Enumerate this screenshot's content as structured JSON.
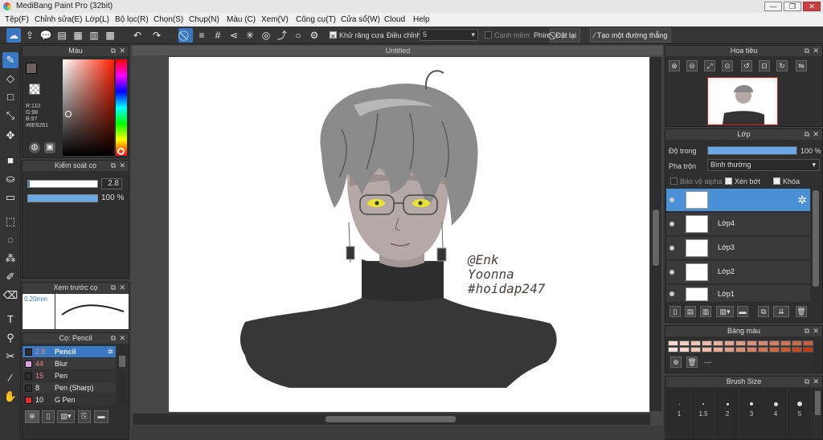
{
  "window": {
    "title": "MediBang Paint Pro (32bit)",
    "min": "—",
    "max": "❐",
    "close": "✕"
  },
  "menu": [
    "Tệp(F)",
    "Chỉnh sửa(E)",
    "Lớp(L)",
    "Bộ lọc(R)",
    "Chọn(S)",
    "Chụp(N)",
    "Màu (C)",
    "Xem(V)",
    "Công cụ(T)",
    "Cửa sổ(W)",
    "Cloud",
    "Help"
  ],
  "toolbar": {
    "antialias_label": "Khử răng cưa",
    "adjust_label": "Điều chỉnh",
    "adjust_value": "5",
    "edge_label": "Cạnh mềm",
    "key_label": "Phím",
    "reset_label": "Đặt lại",
    "new_line_label": "Tạo một đường thẳng"
  },
  "color_panel": {
    "title": "Màu",
    "r": "R:110",
    "g": "G:98",
    "b": "B:97",
    "hex": "#6E6261",
    "primary_color": "#6E6261",
    "hue_color": "#ff2200"
  },
  "brush_control": {
    "title": "Kiểm soát cọ",
    "size_value": "2.8",
    "opacity_value": "100 %"
  },
  "brush_preview": {
    "title": "Xem trước cọ",
    "size_text": "0.20mm"
  },
  "brush_panel": {
    "title": "Cọ: Pencil",
    "items": [
      {
        "size": "2.8",
        "name": "Pencil",
        "color": "#2d2d2d"
      },
      {
        "size": "44",
        "name": "Blur",
        "color": "#e79ee0"
      },
      {
        "size": "15",
        "name": "Pen",
        "color": "#2d2d2d"
      },
      {
        "size": "8",
        "name": "Pen (Sharp)",
        "color": "#2d2d2d"
      },
      {
        "size": "10",
        "name": "G Pen",
        "color": "#e03030"
      }
    ]
  },
  "canvas": {
    "tab_title": "Untitled",
    "signature_line1": "@Enk",
    "signature_line2": "Yoonna",
    "signature_line3": "#hoidap247"
  },
  "navigator": {
    "title": "Hoa tiêu"
  },
  "layers": {
    "title": "Lớp",
    "opacity_label": "Độ trong",
    "opacity_value": "100 %",
    "opacity_fraction": 1.0,
    "blend_label": "Pha trộn",
    "blend_value": "Bình thường",
    "protect_alpha": "Bảo vệ alpha",
    "clipping": "Xén bớt",
    "lock": "Khóa",
    "items": [
      {
        "name": "",
        "selected": true
      },
      {
        "name": "Lớp4",
        "selected": false
      },
      {
        "name": "Lớp3",
        "selected": false
      },
      {
        "name": "Lớp2",
        "selected": false
      },
      {
        "name": "Lớp1",
        "selected": false
      }
    ]
  },
  "palette": {
    "title": "Bảng màu",
    "extra_label": "---",
    "colors": [
      "#f7d9cf",
      "#f4cfc3",
      "#f0c4b6",
      "#ecbaaa",
      "#e8b09e",
      "#e4a692",
      "#e09c86",
      "#dc927a",
      "#d8886e",
      "#d47e62",
      "#d07456",
      "#cc6a4a",
      "#c8603e",
      "#f9e2da",
      "#f6d4c9",
      "#f3c7b8",
      "#eeb9a7",
      "#e9ab96",
      "#e49d85",
      "#df8f74",
      "#da8163",
      "#d57352",
      "#d06541",
      "#cb5730",
      "#c6491f",
      "#c13b0e"
    ]
  },
  "brush_size": {
    "title": "Brush Size",
    "sizes": [
      "1",
      "1.5",
      "2",
      "3",
      "4",
      "5"
    ]
  }
}
